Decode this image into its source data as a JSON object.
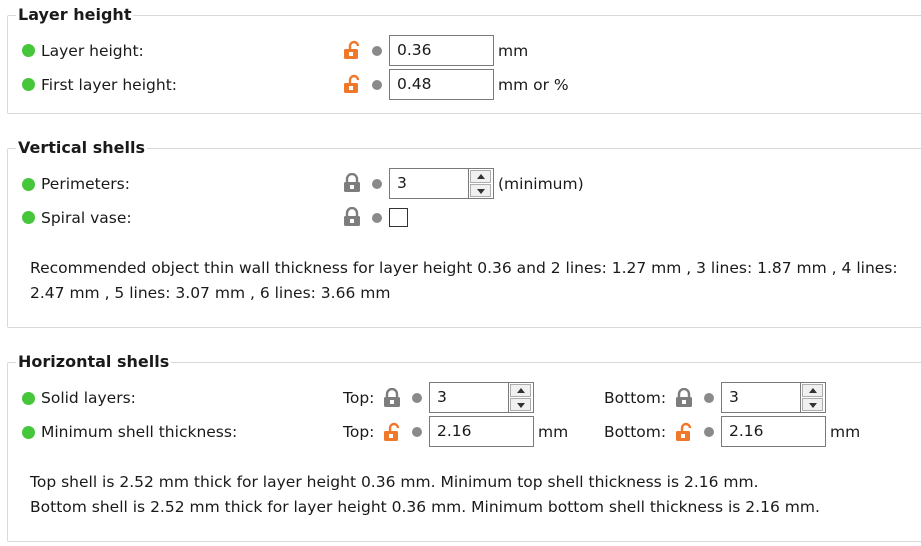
{
  "colors": {
    "accent_unlocked": "#f0782a",
    "locked": "#7d7d7d",
    "green": "#46c63a"
  },
  "layer_height": {
    "title": "Layer height",
    "rows": [
      {
        "label": "Layer height:",
        "lock_icon": "lock-open-icon",
        "value": "0.36",
        "unit": "mm"
      },
      {
        "label": "First layer height:",
        "lock_icon": "lock-open-icon",
        "value": "0.48",
        "unit": "mm or %"
      }
    ]
  },
  "vertical_shells": {
    "title": "Vertical shells",
    "perimeters": {
      "label": "Perimeters:",
      "lock_icon": "lock-closed-icon",
      "value": "3",
      "unit": "(minimum)"
    },
    "spiral": {
      "label": "Spiral vase:",
      "lock_icon": "lock-closed-icon",
      "checked": false
    },
    "info_line1": "Recommended object thin wall thickness for layer height 0.36 and 2 lines: 1.27 mm , 3 lines: 1.87 mm , 4 lines:",
    "info_line2": "2.47 mm , 5 lines: 3.07 mm , 6 lines: 3.66 mm"
  },
  "horizontal_shells": {
    "title": "Horizontal shells",
    "solid": {
      "label": "Solid layers:",
      "top_label": "Top:",
      "top_value": "3",
      "bottom_label": "Bottom:",
      "bottom_value": "3"
    },
    "min_thickness": {
      "label": "Minimum shell thickness:",
      "top_label": "Top:",
      "top_value": "2.16",
      "top_unit": "mm",
      "bottom_label": "Bottom:",
      "bottom_value": "2.16",
      "bottom_unit": "mm"
    },
    "info_line1": "Top shell is 2.52 mm thick for layer height 0.36 mm. Minimum top shell thickness is 2.16 mm.",
    "info_line2": "Bottom shell is 2.52 mm thick for layer height 0.36 mm. Minimum bottom shell thickness is 2.16 mm."
  }
}
